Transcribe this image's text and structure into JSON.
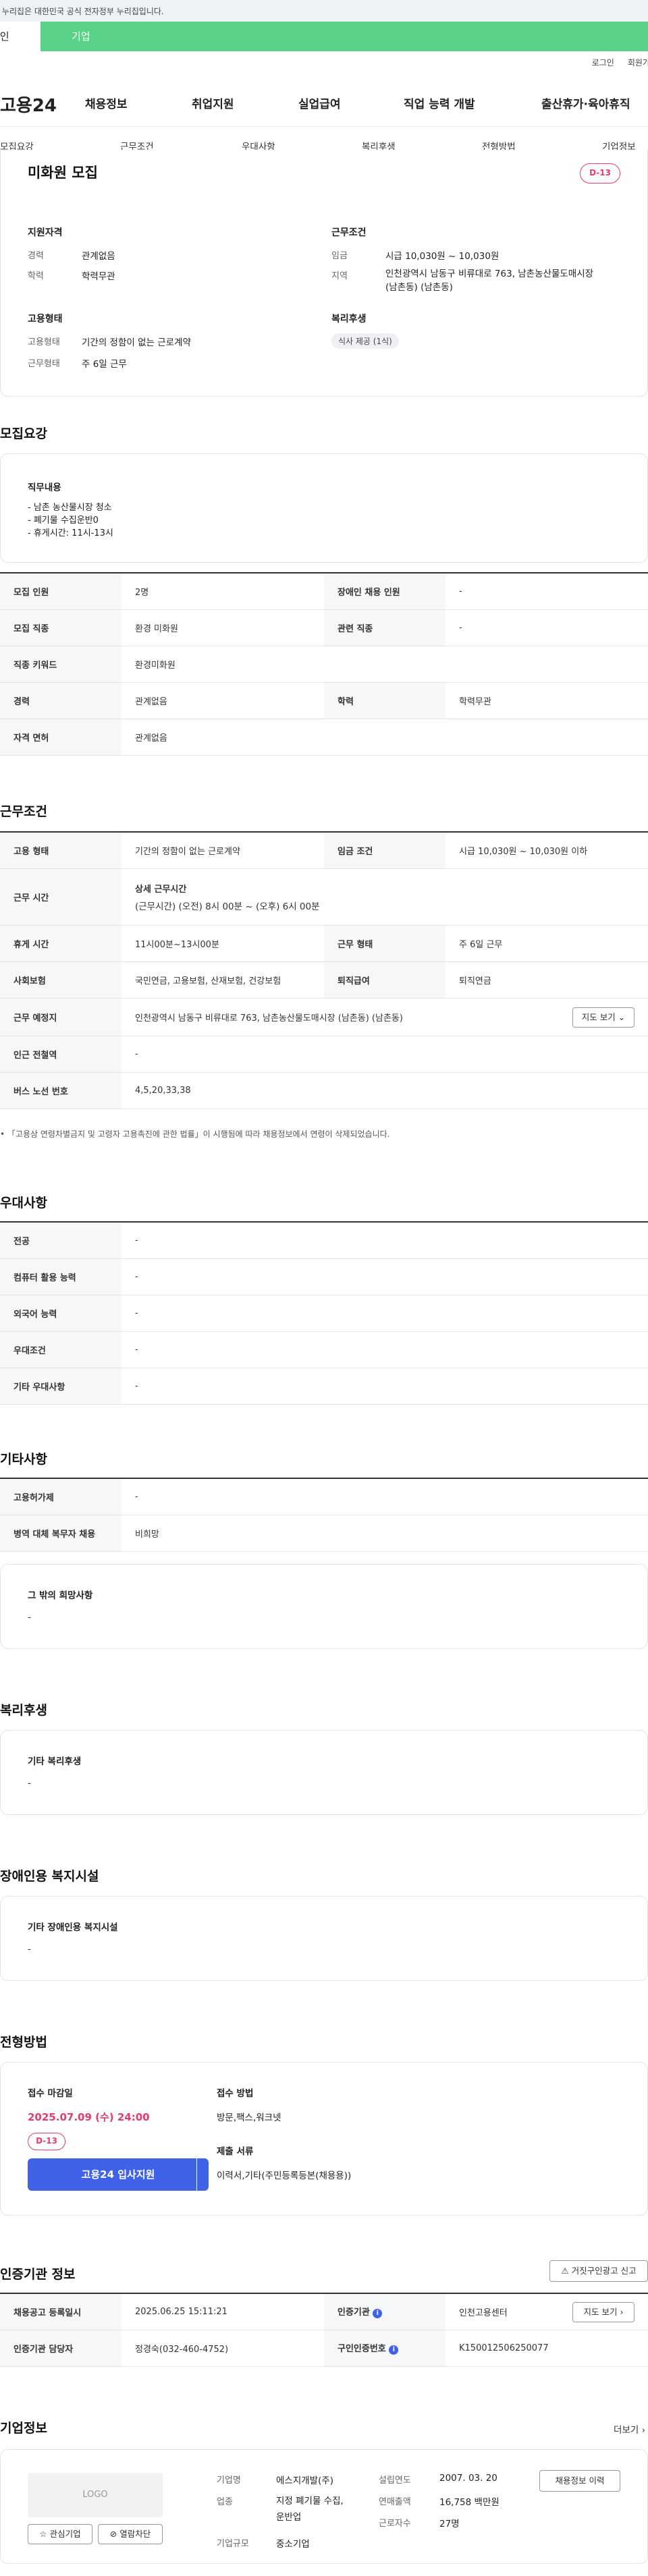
{
  "gov_banner": "이 누리집은 대한민국 공식 전자정부 누리집입니다.",
  "top_tabs": {
    "personal": "개인",
    "company": "기업"
  },
  "util": {
    "login": "로그인",
    "join": "회원가입"
  },
  "gnb": {
    "logo": "고용24",
    "items": [
      "채용정보",
      "취업지원",
      "실업급여",
      "직업 능력 개발",
      "출산휴가·육아휴직"
    ]
  },
  "anchor_tabs": [
    "모집요강",
    "근무조건",
    "우대사항",
    "복리후생",
    "전형방법",
    "기업정보"
  ],
  "summary": {
    "title": "미화원 모집",
    "dday": "D-13",
    "qual_heading": "지원자격",
    "career_label": "경력",
    "career_value": "관계없음",
    "edu_label": "학력",
    "edu_value": "학력무관",
    "emp_heading": "고용형태",
    "emp_type_label": "고용형태",
    "emp_type_value": "기간의 정함이 없는 근로계약",
    "work_form_label": "근무형태",
    "work_form_value": "주 6일 근무",
    "cond_heading": "근무조건",
    "wage_label": "임금",
    "wage_value": "시급 10,030원 ~ 10,030원",
    "region_label": "지역",
    "region_value_1": "인천광역시 남동구 비류대로 763, 남촌농산물도매시장",
    "region_value_2": "(남촌동) (남촌동)",
    "welfare_heading": "복리후생",
    "welfare_chip": "식사 제공 (1식)"
  },
  "recruit": {
    "heading": "모집요강",
    "duty_heading": "직무내용",
    "duty_lines": [
      "- 남촌 농산물시장 청소",
      "- 폐기물 수집운반0",
      "- 휴게시간: 11시-13시"
    ],
    "rows": [
      {
        "k1": "모집 인원",
        "v1": "2명",
        "k2": "장애인 채용 인원",
        "v2": "-"
      },
      {
        "k1": "모집 직종",
        "v1": "환경 미화원",
        "k2": "관련 직종",
        "v2": "-"
      },
      {
        "k1": "직종 키워드",
        "v1": "환경미화원"
      },
      {
        "k1": "경력",
        "v1": "관계없음",
        "k2": "학력",
        "v2": "학력무관"
      },
      {
        "k1": "자격 면허",
        "v1": "관계없음"
      }
    ]
  },
  "work": {
    "heading": "근무조건",
    "emp_type_k": "고용 형태",
    "emp_type_v": "기간의 정함이 없는 근로계약",
    "wage_k": "임금 조건",
    "wage_v": "시급 10,030원 ~ 10,030원 이하",
    "time_k": "근무 시간",
    "time_title": "상세 근무시간",
    "time_v": "(근무시간) (오전) 8시 00분 ~ (오후) 6시 00분",
    "rest_k": "휴게 시간",
    "rest_v": "11시00분~13시00분",
    "form_k": "근무 형태",
    "form_v": "주 6일 근무",
    "ins_k": "사회보험",
    "ins_v": "국민연금, 고용보험, 산재보험, 건강보험",
    "sev_k": "퇴직급여",
    "sev_v": "퇴직연금",
    "place_k": "근무 예정지",
    "place_v": "인천광역시 남동구 비류대로 763, 남촌농산물도매시장 (남촌동) (남촌동)",
    "map_btn": "지도 보기",
    "subway_k": "인근 전철역",
    "subway_v": "-",
    "bus_k": "버스 노선 번호",
    "bus_v": "4,5,20,33,38",
    "note": "「고용상 연령차별금지 및 고령자 고용촉진에 관한 법률」이 시행됨에 따라 채용정보에서 연령이 삭제되었습니다."
  },
  "pref": {
    "heading": "우대사항",
    "rows": [
      [
        "전공",
        "-"
      ],
      [
        "컴퓨터 활용 능력",
        "-"
      ],
      [
        "외국어 능력",
        "-"
      ],
      [
        "우대조건",
        "-"
      ],
      [
        "기타 우대사항",
        "-"
      ]
    ]
  },
  "etc": {
    "heading": "기타사항",
    "rows": [
      [
        "고용허가제",
        "-"
      ],
      [
        "병역 대체 복무자 채용",
        "비희망"
      ]
    ],
    "box_title": "그 밖의 희망사항",
    "box_value": "-"
  },
  "welfare": {
    "heading": "복리후생",
    "box_title": "기타 복리후생",
    "box_value": "-"
  },
  "disabled": {
    "heading": "장애인용 복지시설",
    "box_title": "기타 장애인용 복지시설",
    "box_value": "-"
  },
  "process": {
    "heading": "전형방법",
    "deadline_label": "접수 마감일",
    "deadline_value": "2025.07.09 (수) 24:00",
    "dday": "D-13",
    "apply_btn": "고용24 입사지원",
    "method_label": "접수 방법",
    "method_value": "방문,팩스,워크넷",
    "docs_label": "제출 서류",
    "docs_value": "이력서,기타(주민등록등본(채용용))"
  },
  "cert": {
    "heading": "인증기관 정보",
    "report_btn": "거짓구인광고 신고",
    "reg_k": "채용공고 등록일시",
    "reg_v": "2025.06.25 15:11:21",
    "org_k": "인증기관",
    "org_v": "인천고용센터",
    "map_btn": "지도 보기",
    "mgr_k": "인증기관 담당자",
    "mgr_v": "정경숙(032-460-4752)",
    "no_k": "구인인증번호",
    "no_v": "K150012506250077"
  },
  "company": {
    "heading": "기업정보",
    "more": "더보기",
    "logo": "LOGO",
    "fav_btn": "관심기업",
    "block_btn": "열람차단",
    "name_k": "기업명",
    "name_v": "에스지개발(주)",
    "biz_k": "업종",
    "biz_v1": "지정 폐기물 수집,",
    "biz_v2": "운반업",
    "size_k": "기업규모",
    "size_v": "중소기업",
    "year_k": "설립연도",
    "year_v": "2007. 03. 20",
    "sales_k": "연매출액",
    "sales_v": "16,758 백만원",
    "emp_k": "근로자수",
    "emp_v": "27명",
    "history_btn": "채용정보 이력"
  }
}
